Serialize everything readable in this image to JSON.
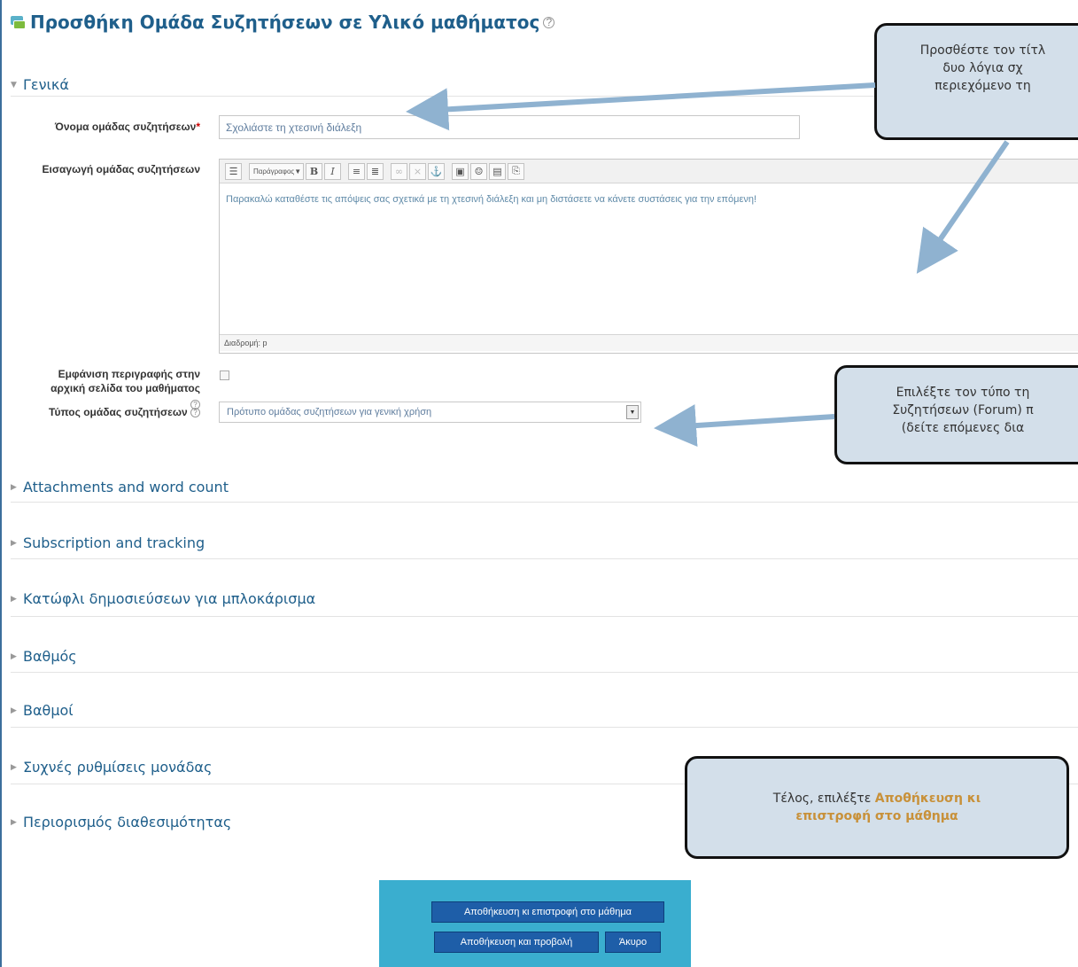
{
  "page_title": "Προσθήκη Ομάδα Συζητήσεων σε Υλικό μαθήματος",
  "general_section": "Γενικά",
  "form": {
    "name_label": "Όνομα ομάδας συζητήσεων",
    "required_mark": "*",
    "name_value": "Σχολιάστε τη χτεσινή διάλεξη",
    "intro_label": "Εισαγωγή ομάδας συζητήσεων",
    "editor_format": "Παράγραφος",
    "editor_text": "Παρακαλώ καταθέστε τις απόψεις σας σχετικά με τη χτεσινή διάλεξη και μη διστάσετε να κάνετε συστάσεις για την επόμενη!",
    "editor_path": "Διαδρομή: p",
    "show_desc_label_1": "Εμφάνιση περιγραφής στην",
    "show_desc_label_2": "αρχική σελίδα του μαθήματος",
    "type_label": "Τύπος ομάδας συζητήσεων",
    "type_value": "Πρότυπο ομάδας συζητήσεων για γενική χρήση"
  },
  "sections": [
    "Attachments and word count",
    "Subscription and tracking",
    "Κατώφλι δημοσιεύσεων για μπλοκάρισμα",
    "Βαθμός",
    "Βαθμοί",
    "Συχνές ρυθμίσεις μονάδας",
    "Περιορισμός διαθεσιμότητας"
  ],
  "callouts": {
    "c1_lines": [
      "Προσθέστε τον τίτλ",
      "δυο λόγια σχ",
      "περιεχόμενο τη"
    ],
    "c2_lines": [
      "Επιλέξτε τον τύπο τη",
      "Συζητήσεων (Forum) π",
      "(δείτε επόμενες δια"
    ],
    "c3_prefix": "Τέλος, επιλέξτε ",
    "c3_highlight_1": "Αποθήκευση κι",
    "c3_highlight_2": "επιστροφή στο μάθημα"
  },
  "buttons": {
    "save_return": "Αποθήκευση κι επιστροφή στο μάθημα",
    "save_display": "Αποθήκευση και προβολή",
    "cancel": "Άκυρο"
  },
  "colors": {
    "title": "#1f5f8b",
    "callout_bg": "#d3dfea",
    "callout_highlight": "#c8913a",
    "button": "#1e5ea8",
    "button_panel": "#3aaecf",
    "arrow": "#8fb2d0"
  }
}
